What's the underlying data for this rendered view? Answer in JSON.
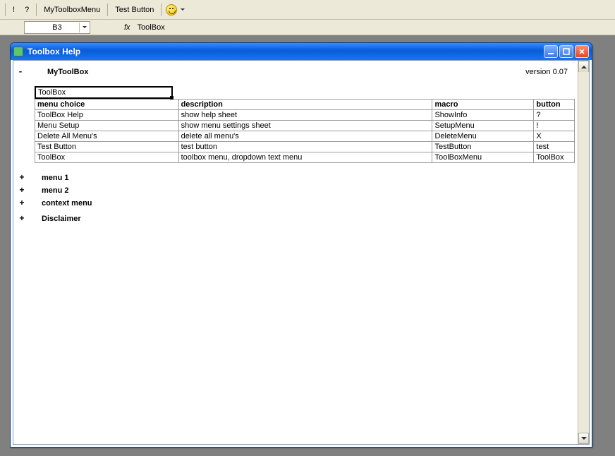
{
  "toolbar": {
    "bang": "!",
    "qmark": "?",
    "menu_btn": "MyToolboxMenu",
    "test_btn": "Test Button"
  },
  "formula_bar": {
    "cell_ref": "B3",
    "fx_label": "fx",
    "fx_value": "ToolBox"
  },
  "window": {
    "title": "Toolbox Help"
  },
  "help": {
    "heading": "MyToolBox",
    "version": "version 0.07",
    "active_cell_value": "ToolBox",
    "headers": {
      "menu_choice": "menu choice",
      "description": "description",
      "macro": "macro",
      "button": "button"
    },
    "rows": [
      {
        "menu_choice": "ToolBox Help",
        "description": "show help sheet",
        "macro": "ShowInfo",
        "button": "?"
      },
      {
        "menu_choice": "Menu Setup",
        "description": "show menu settings sheet",
        "macro": "SetupMenu",
        "button": "!"
      },
      {
        "menu_choice": "Delete All Menu's",
        "description": "delete all menu's",
        "macro": "DeleteMenu",
        "button": "X"
      },
      {
        "menu_choice": "Test Button",
        "description": "test button",
        "macro": "TestButton",
        "button": "test"
      },
      {
        "menu_choice": "ToolBox",
        "description": "toolbox menu, dropdown text menu",
        "macro": "ToolBoxMenu",
        "button": "ToolBox"
      }
    ],
    "outline": [
      {
        "toggle": "+",
        "label": "menu  1"
      },
      {
        "toggle": "+",
        "label": "menu 2"
      },
      {
        "toggle": "+",
        "label": "context menu"
      },
      {
        "toggle": "+",
        "label": "Disclaimer"
      }
    ]
  }
}
